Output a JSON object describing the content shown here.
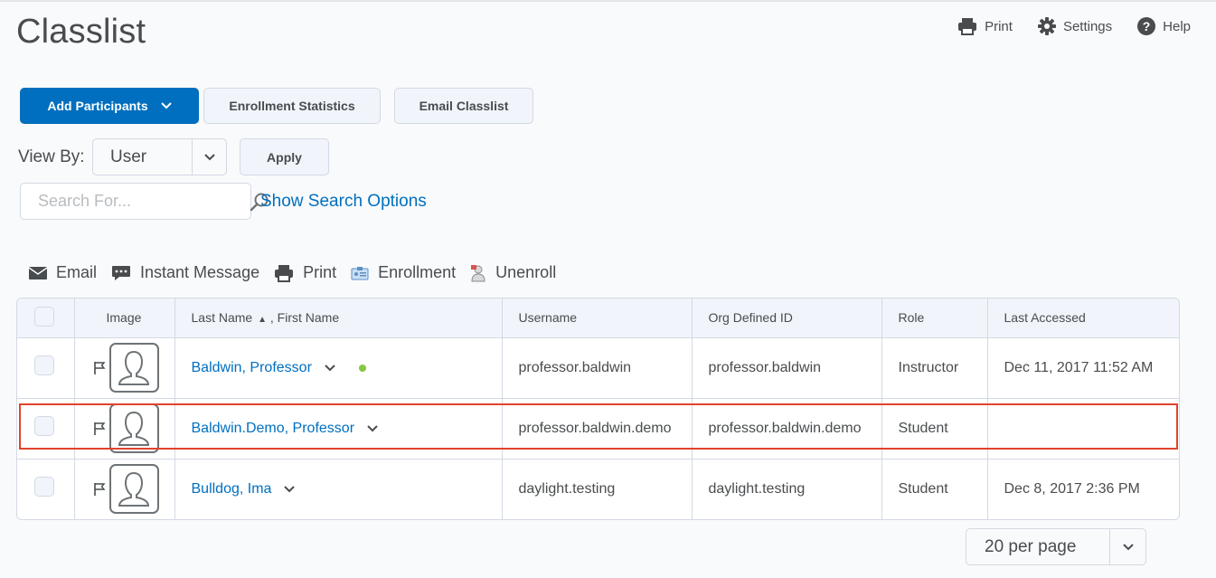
{
  "page": {
    "title": "Classlist"
  },
  "top_actions": [
    {
      "label": "Print",
      "icon": "printer-icon"
    },
    {
      "label": "Settings",
      "icon": "gear-icon"
    },
    {
      "label": "Help",
      "icon": "help-icon"
    }
  ],
  "buttons": {
    "add_participants": "Add Participants",
    "enrollment_statistics": "Enrollment Statistics",
    "email_classlist": "Email Classlist",
    "apply": "Apply"
  },
  "view_by": {
    "label": "View By:",
    "selected": "User"
  },
  "search": {
    "placeholder": "Search For...",
    "value": "",
    "show_options": "Show Search Options"
  },
  "actions": [
    {
      "label": "Email",
      "icon": "envelope-icon"
    },
    {
      "label": "Instant Message",
      "icon": "chat-icon"
    },
    {
      "label": "Print",
      "icon": "printer-icon"
    },
    {
      "label": "Enrollment",
      "icon": "enrollment-icon"
    },
    {
      "label": "Unenroll",
      "icon": "unenroll-icon"
    }
  ],
  "table": {
    "headers": {
      "image": "Image",
      "last_name": "Last Name",
      "first_name": ", First Name",
      "username": "Username",
      "org_id": "Org Defined ID",
      "role": "Role",
      "last_accessed": "Last Accessed"
    },
    "sort": "ascending",
    "rows": [
      {
        "name": "Baldwin, Professor",
        "username": "professor.baldwin",
        "org_id": "professor.baldwin",
        "role": "Instructor",
        "last_accessed": "Dec 11, 2017 11:52 AM",
        "online": true
      },
      {
        "name": "Baldwin.Demo, Professor",
        "username": "professor.baldwin.demo",
        "org_id": "professor.baldwin.demo",
        "role": "Student",
        "last_accessed": "",
        "online": false,
        "highlighted": true
      },
      {
        "name": "Bulldog, Ima",
        "username": "daylight.testing",
        "org_id": "daylight.testing",
        "role": "Student",
        "last_accessed": "Dec 8, 2017 2:36 PM",
        "online": false
      }
    ]
  },
  "pagination": {
    "per_page": "20 per page"
  },
  "colors": {
    "primary": "#006fbf",
    "highlight": "#e0432c",
    "online": "#8ac640"
  }
}
